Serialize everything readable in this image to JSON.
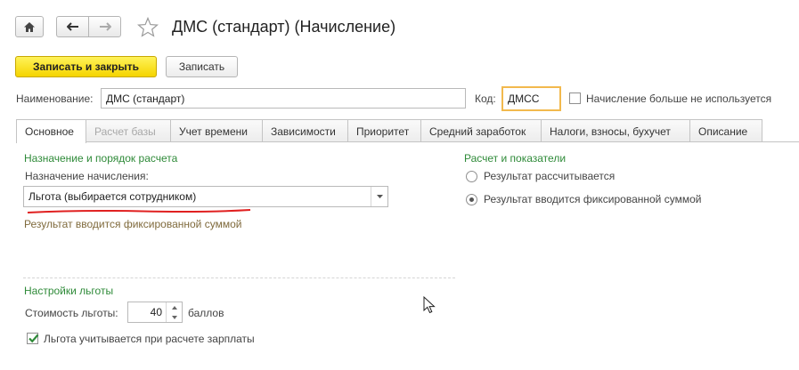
{
  "window": {
    "title": "ДМС (стандарт) (Начисление)"
  },
  "icons": {
    "home": "home-icon",
    "back": "arrow-left-icon",
    "forward": "arrow-right-icon",
    "favorite": "star-icon",
    "dropdown": "chevron-down-icon"
  },
  "colors": {
    "primary_button": "#f5d400",
    "group_title": "#2e8a38",
    "hint": "#7f6a3c",
    "focus_border": "#f2b94d",
    "checkmark": "#2e8a38",
    "underline": "#e02020"
  },
  "toolbar": {
    "save_close_label": "Записать и закрыть",
    "save_label": "Записать"
  },
  "form": {
    "name_label": "Наименование:",
    "name_value": "ДМС (стандарт)",
    "code_label": "Код:",
    "code_value": "ДМСС",
    "unused_label": "Начисление больше не используется",
    "unused_checked": false
  },
  "tabs": [
    {
      "label": "Основное",
      "active": true,
      "disabled": false
    },
    {
      "label": "Расчет базы",
      "active": false,
      "disabled": true
    },
    {
      "label": "Учет времени",
      "active": false,
      "disabled": false
    },
    {
      "label": "Зависимости",
      "active": false,
      "disabled": false
    },
    {
      "label": "Приоритет",
      "active": false,
      "disabled": false
    },
    {
      "label": "Средний заработок",
      "active": false,
      "disabled": false
    },
    {
      "label": "Налоги, взносы, бухучет",
      "active": false,
      "disabled": false
    },
    {
      "label": "Описание",
      "active": false,
      "disabled": false
    }
  ],
  "main": {
    "purpose_group_title": "Назначение и порядок расчета",
    "purpose_label": "Назначение начисления:",
    "purpose_value": "Льгота (выбирается сотрудником)",
    "result_hint": "Результат вводится фиксированной суммой",
    "results_group_title": "Расчет и показатели",
    "radio_calculated": "Результат рассчитывается",
    "radio_fixed": "Результат вводится фиксированной суммой",
    "radio_selected": "fixed",
    "benefit_group_title": "Настройки льготы",
    "cost_label": "Стоимость льготы:",
    "cost_value": "40",
    "cost_unit": "баллов",
    "payroll_label": "Льгота учитывается при расчете зарплаты",
    "payroll_checked": true
  }
}
